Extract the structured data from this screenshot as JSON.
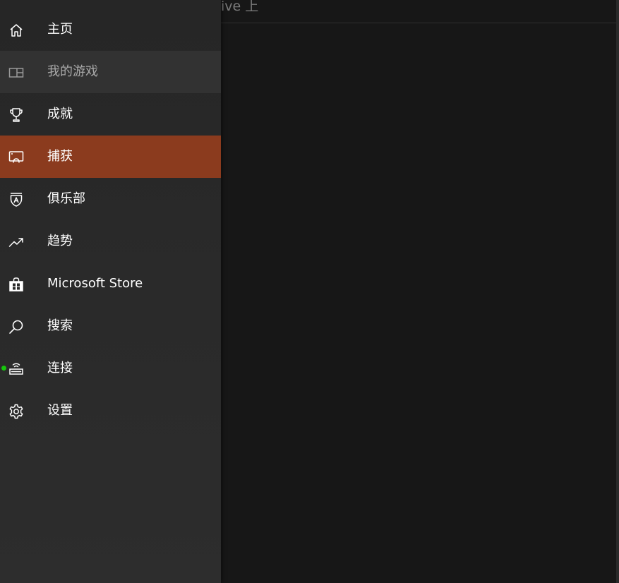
{
  "content": {
    "header_text": "ive 上"
  },
  "colors": {
    "sidebar_bg": "#2a2a2a",
    "content_bg": "#171717",
    "active_item_bg": "#8b3b1e",
    "dim_item_bg": "#323232",
    "status_green": "#16c60c"
  },
  "sidebar": {
    "items": [
      {
        "label": "主页",
        "icon": "home-icon",
        "state": "normal"
      },
      {
        "label": "我的游戏",
        "icon": "my-games-icon",
        "state": "dim"
      },
      {
        "label": "成就",
        "icon": "trophy-icon",
        "state": "normal"
      },
      {
        "label": "捕获",
        "icon": "capture-icon",
        "state": "active"
      },
      {
        "label": "俱乐部",
        "icon": "club-shield-icon",
        "state": "normal"
      },
      {
        "label": "趋势",
        "icon": "trending-icon",
        "state": "normal"
      },
      {
        "label": "Microsoft Store",
        "icon": "store-bag-icon",
        "state": "normal"
      },
      {
        "label": "搜索",
        "icon": "search-icon",
        "state": "normal"
      },
      {
        "label": "连接",
        "icon": "console-connect-icon",
        "state": "normal",
        "status": "connected"
      },
      {
        "label": "设置",
        "icon": "gear-icon",
        "state": "normal"
      }
    ]
  }
}
